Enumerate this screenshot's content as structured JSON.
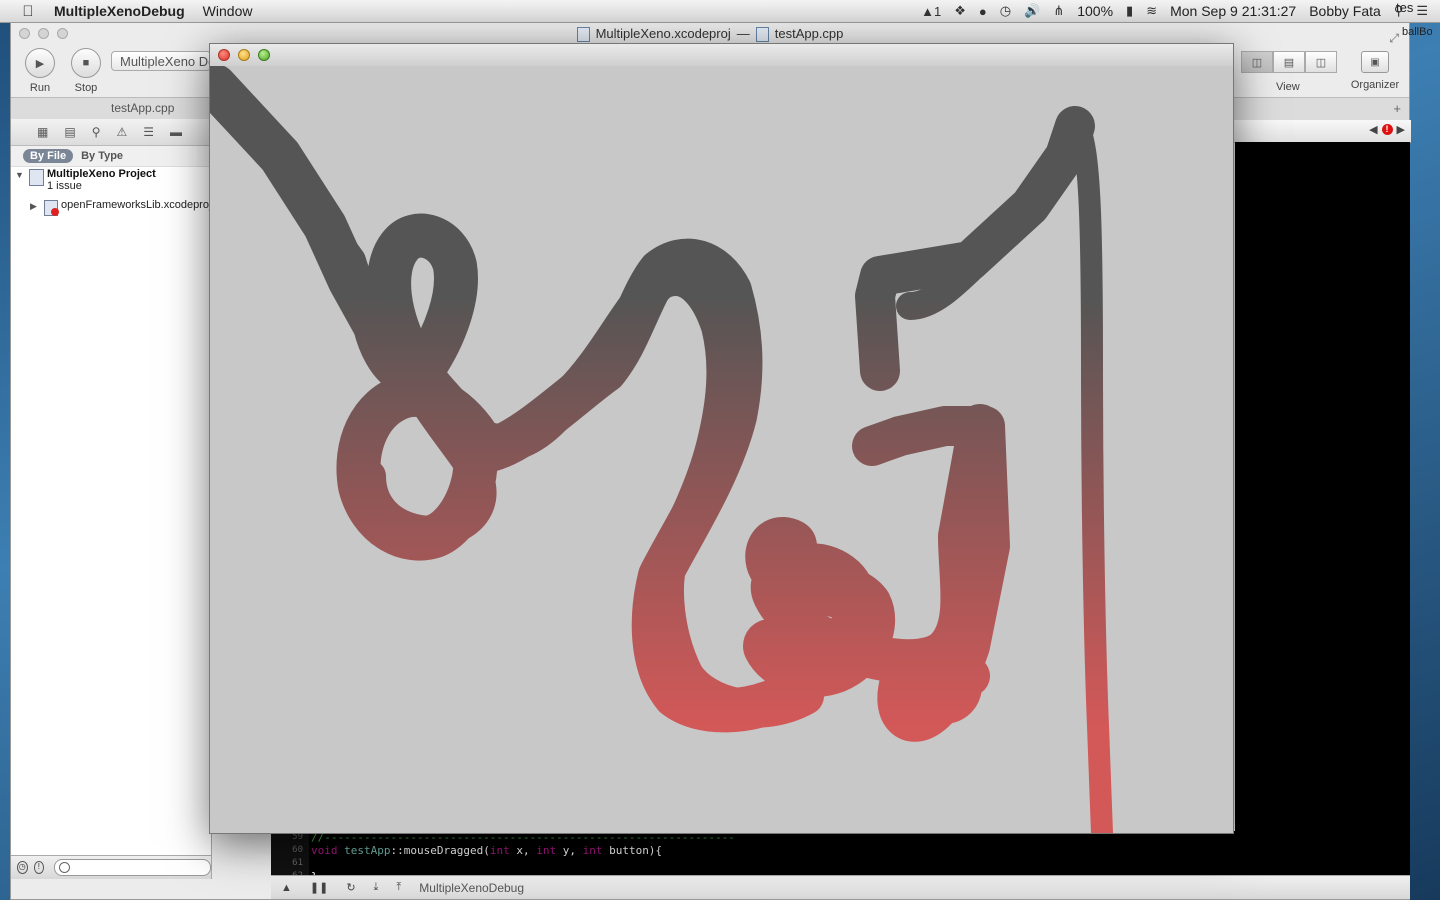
{
  "menubar": {
    "app_name": "MultipleXenoDebug",
    "menus": [
      "Window"
    ],
    "status": {
      "notifications": "1",
      "battery": "100%",
      "datetime": "Mon Sep 9  21:31:27",
      "user": "Bobby Fata"
    }
  },
  "xcode": {
    "window_title_project": "MultipleXeno.xcodeproj",
    "window_title_sep": "—",
    "window_title_file": "testApp.cpp",
    "toolbar": {
      "run_label": "Run",
      "stop_label": "Stop",
      "scheme": "MultipleXeno Debug",
      "view_label": "View",
      "organizer_label": "Organizer"
    },
    "tab_label": "testApp.cpp",
    "navigator": {
      "filter_active": "By File",
      "filter_other": "By Type",
      "project_name": "MultipleXeno Project",
      "project_issues": "1 issue",
      "child_item": "openFrameworksLib.xcodeproj"
    },
    "peek_text": "tes",
    "peek_text2": "ballBo",
    "code": {
      "line_numbers": [
        "59",
        "60",
        "61",
        "62"
      ],
      "comment_line": "//--------------------------------------------------------------",
      "line60": {
        "kw_void": "void",
        "cls": "testApp",
        "sep": "::",
        "fn": "mouseDragged(",
        "kw_int1": "int",
        "arg1": " x, ",
        "kw_int2": "int",
        "arg2": " y, ",
        "kw_int3": "int",
        "arg3": " button){"
      },
      "line62": "}"
    },
    "debug_target": "MultipleXenoDebug"
  },
  "app_window": {
    "stroke_colors": {
      "top": "#555555",
      "bottom": "#d35858"
    },
    "background": "#c8c8c8"
  }
}
